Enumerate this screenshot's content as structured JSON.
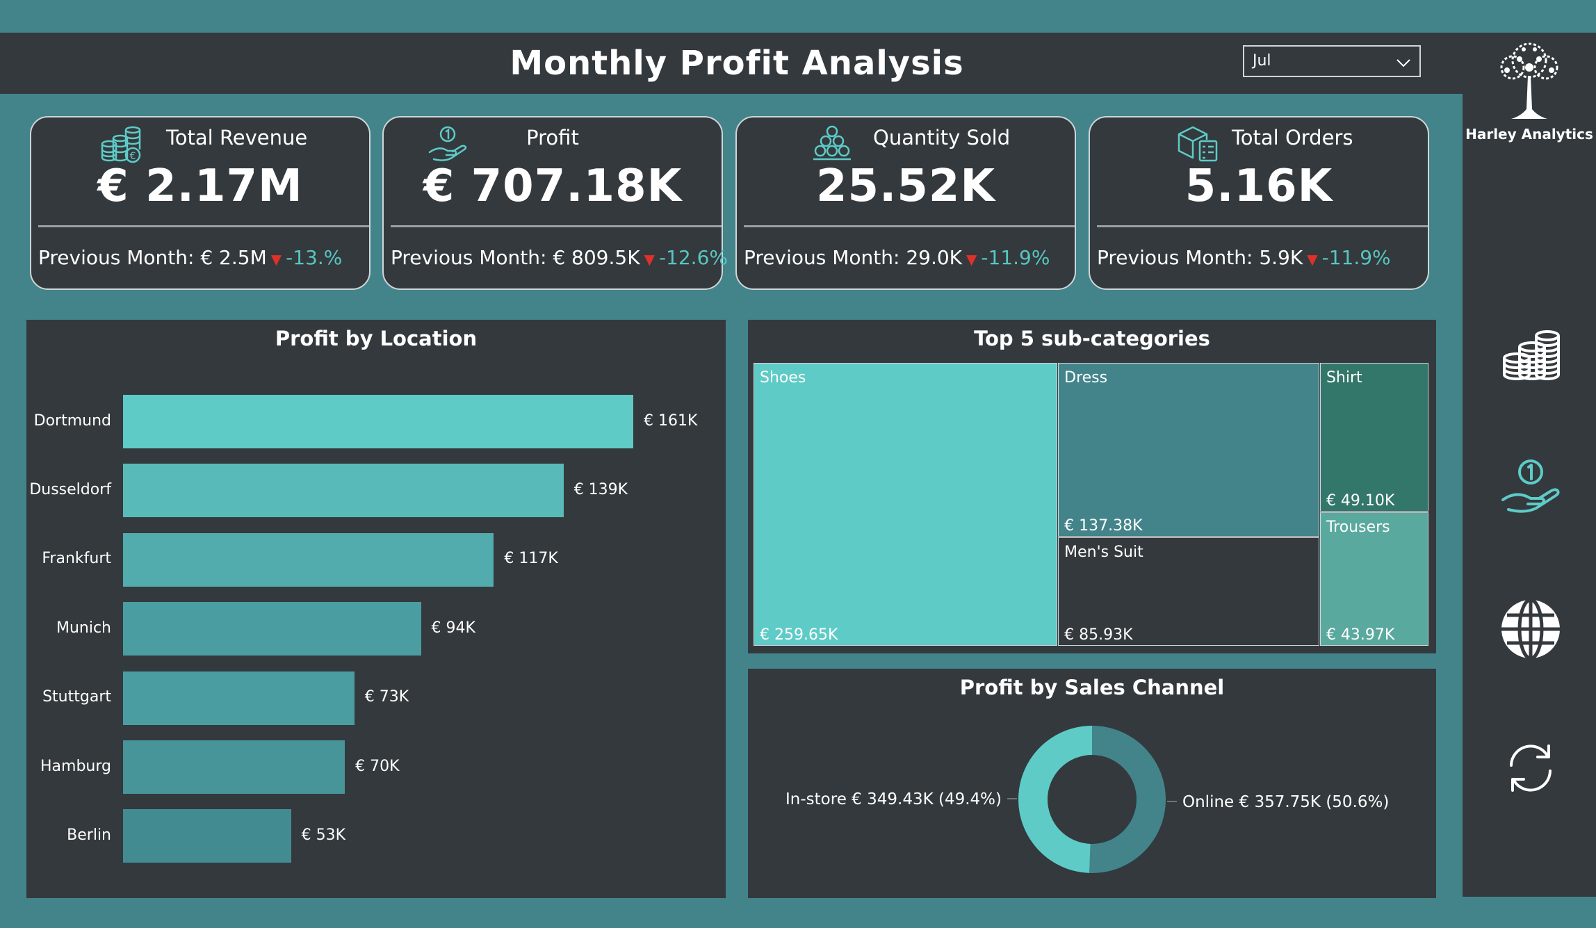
{
  "header": {
    "title": "Monthly Profit Analysis",
    "month_selected": "Jul"
  },
  "sidebar": {
    "brand": "Harley Analytics",
    "icons": [
      "coins-icon",
      "hand-coin-icon",
      "globe-icon",
      "refresh-icon"
    ]
  },
  "kpis": [
    {
      "title": "Total Revenue",
      "value": "€ 2.17M",
      "previous": "Previous Month: € 2.5M",
      "delta": "-13.%",
      "icon": "coin-stacks-icon"
    },
    {
      "title": "Profit",
      "value": "€ 707.18K",
      "previous": "Previous Month: € 809.5K",
      "delta": "-12.6%",
      "icon": "hand-coin-icon"
    },
    {
      "title": "Quantity Sold",
      "value": "25.52K",
      "previous": "Previous Month: 29.0K",
      "delta": "-11.9%",
      "icon": "coin-pyramid-icon"
    },
    {
      "title": "Total Orders",
      "value": "5.16K",
      "previous": "Previous Month: 5.9K",
      "delta": "-11.9%",
      "icon": "box-checklist-icon"
    }
  ],
  "location_panel": {
    "title": "Profit by Location"
  },
  "treemap_panel": {
    "title": "Top 5 sub-categories"
  },
  "channel_panel": {
    "title": "Profit by Sales Channel"
  },
  "colors": {
    "accent": "#5ecbc7",
    "panel": "#33393d",
    "background": "#43848b",
    "negative": "#e0302b"
  },
  "chart_data": [
    {
      "type": "bar",
      "title": "Profit by Location",
      "categories": [
        "Dortmund",
        "Dusseldorf",
        "Frankfurt",
        "Munich",
        "Stuttgart",
        "Hamburg",
        "Berlin"
      ],
      "values": [
        161,
        139,
        117,
        94,
        73,
        70,
        53
      ],
      "value_labels": [
        "€ 161K",
        "€ 139K",
        "€ 117K",
        "€ 94K",
        "€ 73K",
        "€ 70K",
        "€ 53K"
      ],
      "unit": "K€",
      "colors": [
        "#5ecbc7",
        "#58bbb9",
        "#52acad",
        "#4a9ea1",
        "#4a9ea1",
        "#479499",
        "#428b91"
      ]
    },
    {
      "type": "treemap",
      "title": "Top 5 sub-categories",
      "categories": [
        "Shoes",
        "Dress",
        "Men's Suit",
        "Shirt",
        "Trousers"
      ],
      "values": [
        259.65,
        137.38,
        85.93,
        49.1,
        43.97
      ],
      "value_labels": [
        "€ 259.65K",
        "€ 137.38K",
        "€ 85.93K",
        "€ 49.10K",
        "€ 43.97K"
      ],
      "colors": [
        "#5ecbc7",
        "#43848b",
        "#33393d",
        "#33776a",
        "#5aa99e"
      ]
    },
    {
      "type": "pie",
      "subtype": "donut",
      "title": "Profit by Sales Channel",
      "categories": [
        "In-store",
        "Online"
      ],
      "values": [
        349.43,
        357.75
      ],
      "percent": [
        49.4,
        50.6
      ],
      "labels": [
        "In-store € 349.43K (49.4%)",
        "Online € 357.75K (50.6%)"
      ],
      "colors": [
        "#5ecbc7",
        "#43848b"
      ]
    }
  ]
}
